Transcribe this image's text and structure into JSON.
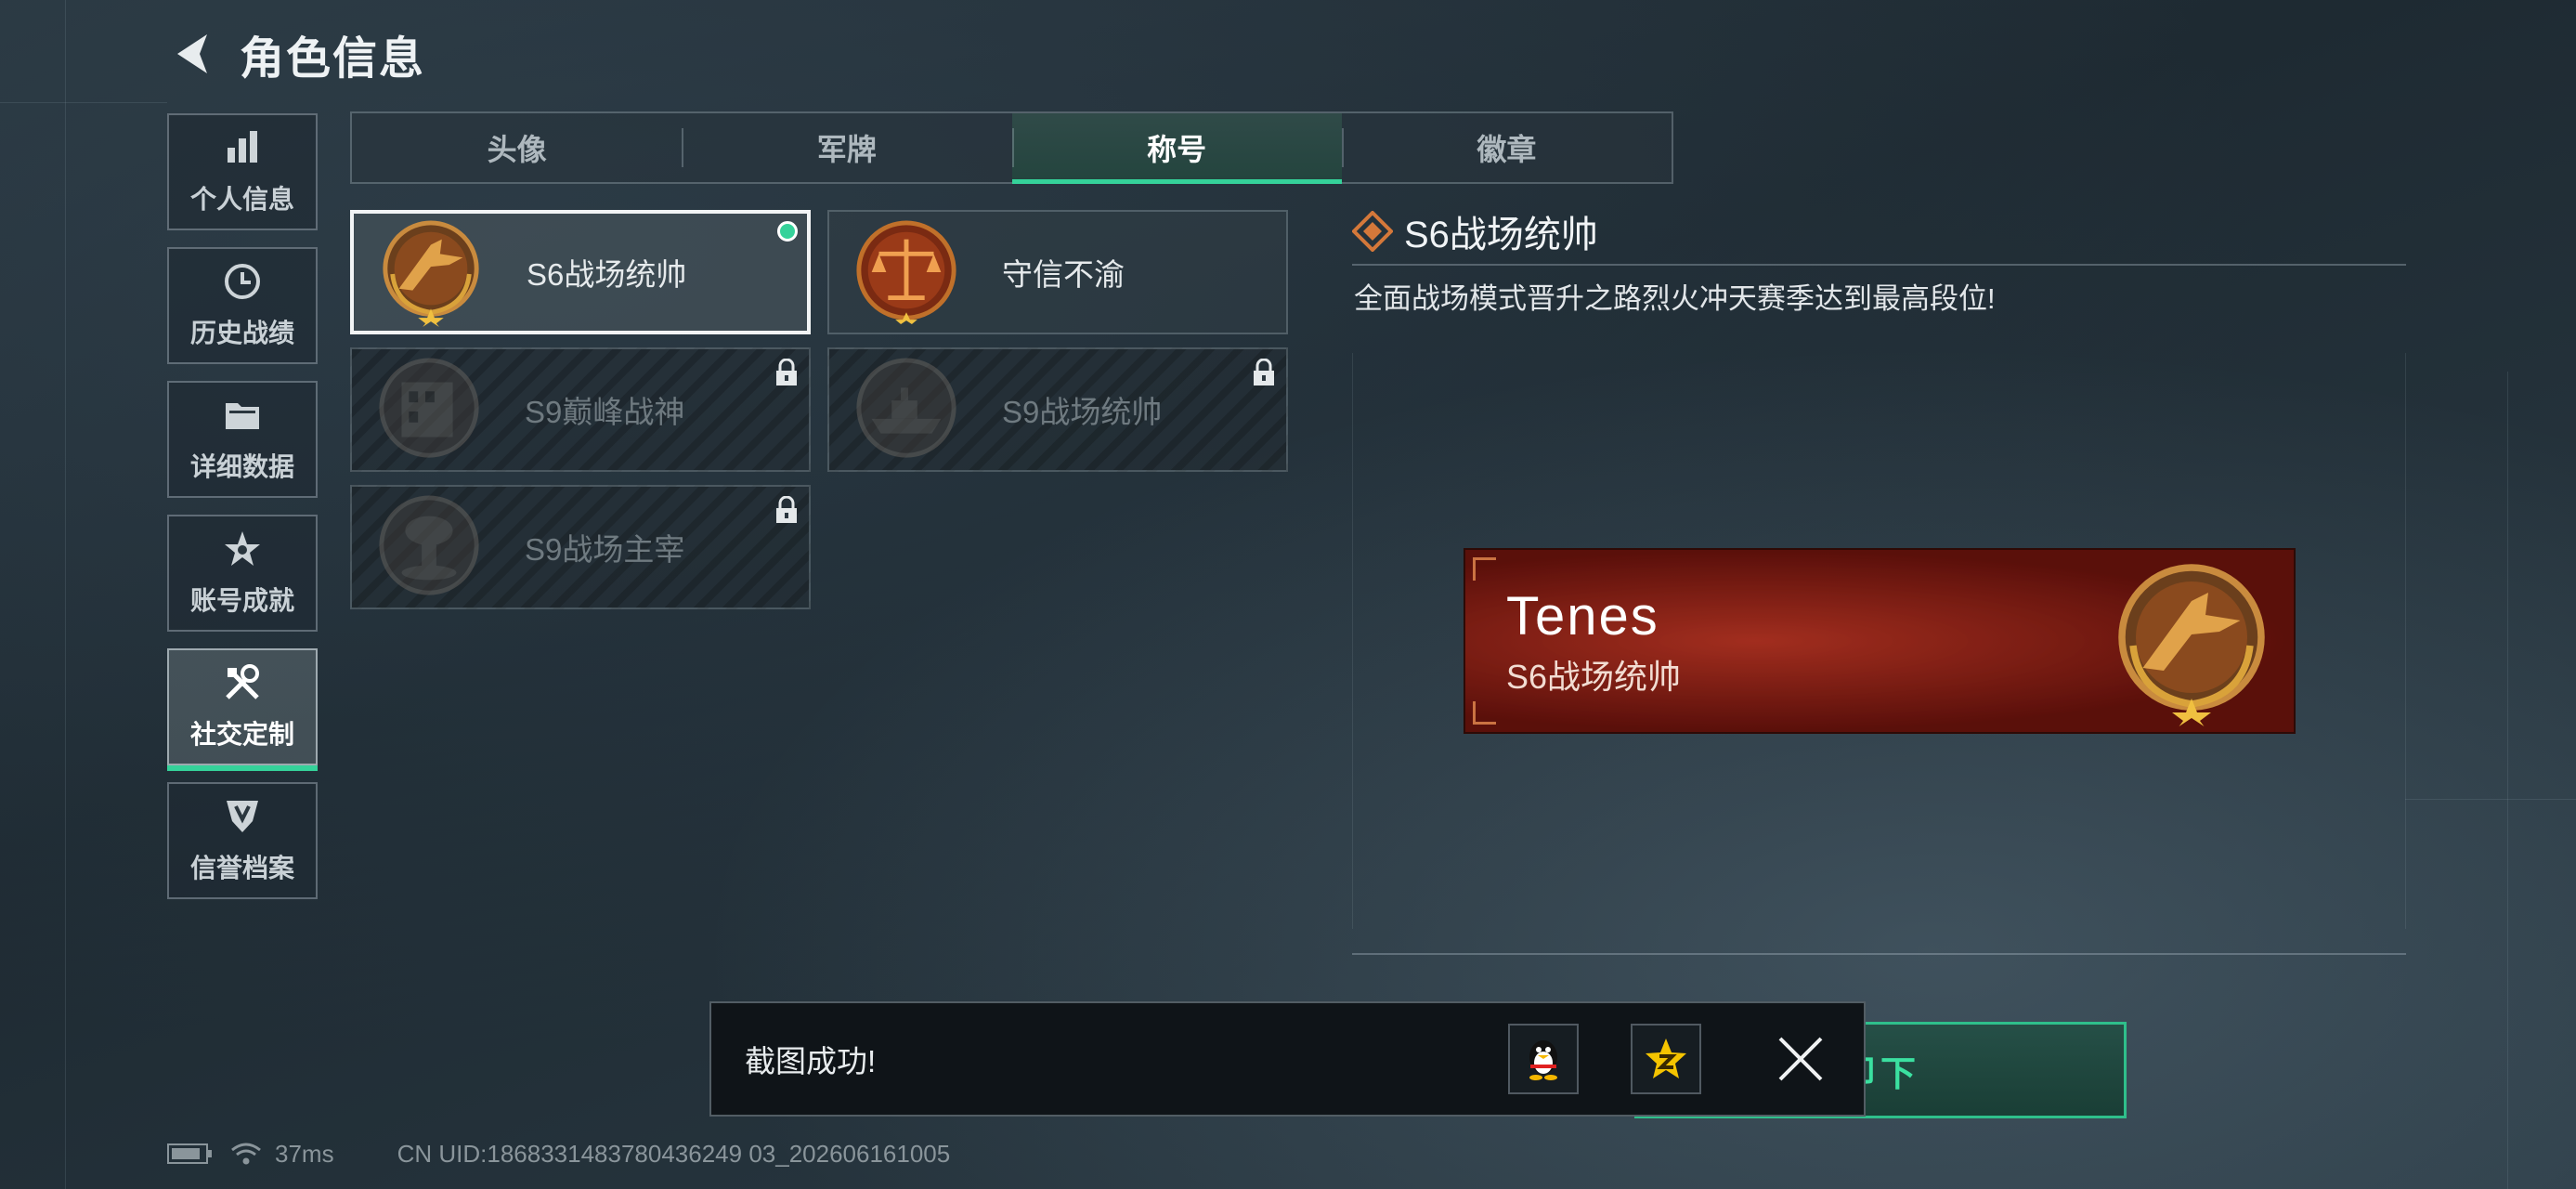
{
  "header": {
    "title": "角色信息"
  },
  "sidebar": {
    "items": [
      {
        "label": "个人信息",
        "icon": "bar-chart-icon",
        "active": false
      },
      {
        "label": "历史战绩",
        "icon": "clock-icon",
        "active": false
      },
      {
        "label": "详细数据",
        "icon": "folder-icon",
        "active": false
      },
      {
        "label": "账号成就",
        "icon": "achievement-star-icon",
        "active": false
      },
      {
        "label": "社交定制",
        "icon": "tools-icon",
        "active": true
      },
      {
        "label": "信誉档案",
        "icon": "shield-emblem-icon",
        "active": false
      }
    ]
  },
  "tabs": [
    {
      "label": "头像",
      "active": false
    },
    {
      "label": "军牌",
      "active": false
    },
    {
      "label": "称号",
      "active": true
    },
    {
      "label": "徽章",
      "active": false
    }
  ],
  "titles": [
    {
      "label": "S6战场统帅",
      "emblem": "fighter-jet-emblem-icon",
      "selected": true,
      "locked": false
    },
    {
      "label": "守信不渝",
      "emblem": "scales-emblem-icon",
      "selected": false,
      "locked": false
    },
    {
      "label": "S9巅峰战神",
      "emblem": "building-emblem-icon",
      "selected": false,
      "locked": true
    },
    {
      "label": "S9战场统帅",
      "emblem": "warship-emblem-icon",
      "selected": false,
      "locked": true
    },
    {
      "label": "S9战场主宰",
      "emblem": "mushroom-cloud-emblem-icon",
      "selected": false,
      "locked": true
    }
  ],
  "detail": {
    "title": "S6战场统帅",
    "description": "全面战场模式晋升之路烈火冲天赛季达到最高段位!"
  },
  "nameplate": {
    "player_name": "Tenes",
    "title": "S6战场统帅"
  },
  "unequip_button": {
    "label": "卸下"
  },
  "toast": {
    "message": "截图成功!",
    "share_icons": [
      "qq-penguin-icon",
      "qzone-star-icon"
    ],
    "close_icon": "close-icon"
  },
  "status_bar": {
    "ping": "37ms",
    "uid": "CN UID:1868331483780436249 03_202606161005"
  },
  "colors": {
    "accent": "#35d29a",
    "nameplate_red": "#8a1a12",
    "emblem_bronze": "#b5722c"
  }
}
